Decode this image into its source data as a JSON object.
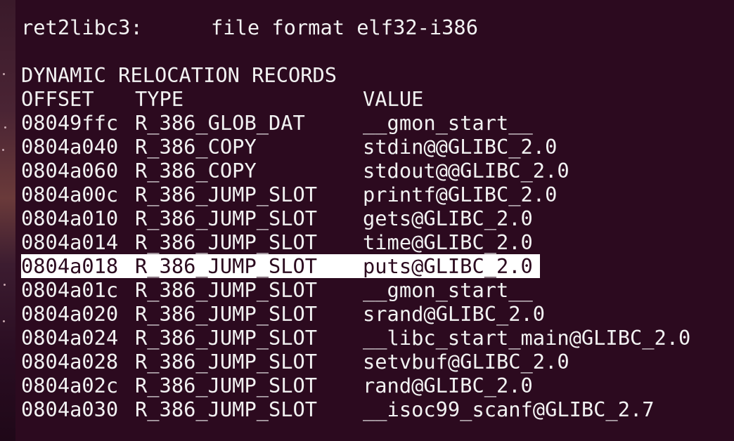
{
  "terminal": {
    "header_name": "ret2libc3:",
    "header_format": "file format elf32-i386",
    "section_title": "DYNAMIC RELOCATION RECORDS",
    "columns": [
      "OFFSET",
      "TYPE",
      "VALUE"
    ],
    "rows": [
      {
        "offset": "08049ffc",
        "type": "R_386_GLOB_DAT",
        "value": "__gmon_start__"
      },
      {
        "offset": "0804a040",
        "type": "R_386_COPY",
        "value": "stdin@@GLIBC_2.0"
      },
      {
        "offset": "0804a060",
        "type": "R_386_COPY",
        "value": "stdout@@GLIBC_2.0"
      },
      {
        "offset": "0804a00c",
        "type": "R_386_JUMP_SLOT",
        "value": "printf@GLIBC_2.0"
      },
      {
        "offset": "0804a010",
        "type": "R_386_JUMP_SLOT",
        "value": "gets@GLIBC_2.0"
      },
      {
        "offset": "0804a014",
        "type": "R_386_JUMP_SLOT",
        "value": "time@GLIBC_2.0"
      },
      {
        "offset": "0804a018",
        "type": "R_386_JUMP_SLOT",
        "value": "puts@GLIBC_2.0"
      },
      {
        "offset": "0804a01c",
        "type": "R_386_JUMP_SLOT",
        "value": "__gmon_start__"
      },
      {
        "offset": "0804a020",
        "type": "R_386_JUMP_SLOT",
        "value": "srand@GLIBC_2.0"
      },
      {
        "offset": "0804a024",
        "type": "R_386_JUMP_SLOT",
        "value": "__libc_start_main@GLIBC_2.0"
      },
      {
        "offset": "0804a028",
        "type": "R_386_JUMP_SLOT",
        "value": "setvbuf@GLIBC_2.0"
      },
      {
        "offset": "0804a02c",
        "type": "R_386_JUMP_SLOT",
        "value": "rand@GLIBC_2.0"
      },
      {
        "offset": "0804a030",
        "type": "R_386_JUMP_SLOT",
        "value": "__isoc99_scanf@GLIBC_2.7"
      }
    ],
    "selected_row_index": 6
  },
  "colors": {
    "background": "#2c0a1f",
    "text": "#f2f2f2",
    "selection": "#ffffff"
  }
}
